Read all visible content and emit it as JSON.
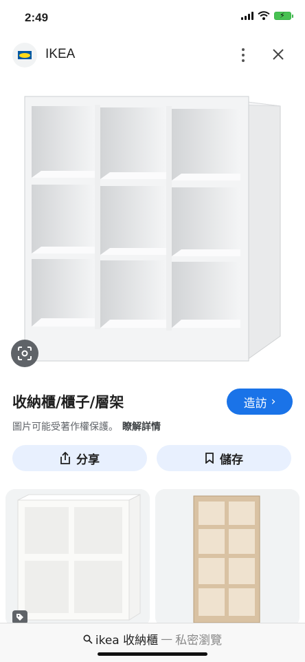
{
  "status_bar": {
    "time": "2:49"
  },
  "header": {
    "site_name": "IKEA"
  },
  "result": {
    "title": "收納櫃/櫃子/層架",
    "visit_label": "造訪",
    "visit_chevron": "›",
    "copyright_notice": "圖片可能受著作權保護。",
    "learn_more": "瞭解詳情"
  },
  "actions": {
    "share_label": "分享",
    "save_label": "儲存"
  },
  "bottom_bar": {
    "query": "ikea 收納櫃",
    "separator": "—",
    "mode": "私密瀏覽"
  },
  "colors": {
    "accent": "#1a73e8",
    "chip_bg": "#e8f0fe",
    "battery": "#47c152"
  },
  "icons": [
    "signal-icon",
    "wifi-icon",
    "battery-icon",
    "more-icon",
    "close-icon",
    "lens-icon",
    "share-icon",
    "bookmark-icon",
    "tag-icon",
    "search-icon"
  ]
}
